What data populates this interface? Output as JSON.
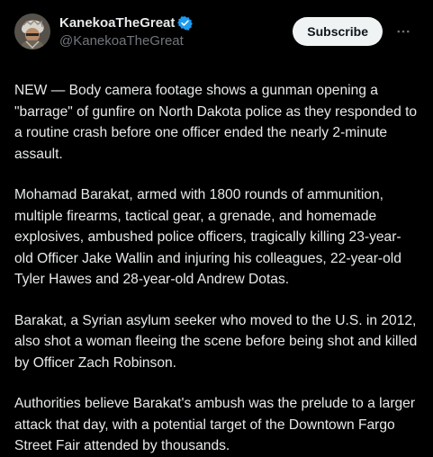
{
  "author": {
    "display_name": "KanekoaTheGreat",
    "handle": "@KanekoaTheGreat",
    "verified_badge_icon": "verified-badge-icon",
    "verified_color": "#1d9bf0"
  },
  "actions": {
    "subscribe_label": "Subscribe",
    "more_icon": "more-options-icon"
  },
  "post": {
    "paragraphs": [
      "NEW — Body camera footage shows a gunman opening a \"barrage\" of gunfire on North Dakota police as they responded to a routine crash before one officer ended the nearly 2-minute assault.",
      "Mohamad Barakat, armed with 1800 rounds of ammunition, multiple firearms, tactical gear, a grenade, and homemade explosives, ambushed police officers, tragically killing 23-year-old Officer Jake Wallin and injuring his colleagues, 22-year-old Tyler Hawes and 28-year-old Andrew Dotas.",
      "Barakat, a Syrian asylum seeker who moved to the U.S. in 2012, also shot a woman fleeing the scene before being shot and killed by Officer Zach Robinson.",
      "Authorities believe Barakat's ambush was the prelude to a larger attack that day, with a potential target of the Downtown Fargo Street Fair attended by thousands."
    ]
  },
  "colors": {
    "background": "#000000",
    "text": "#e7e9ea",
    "secondary_text": "#71767b",
    "button_bg": "#eff3f4",
    "button_text": "#0f1419"
  }
}
